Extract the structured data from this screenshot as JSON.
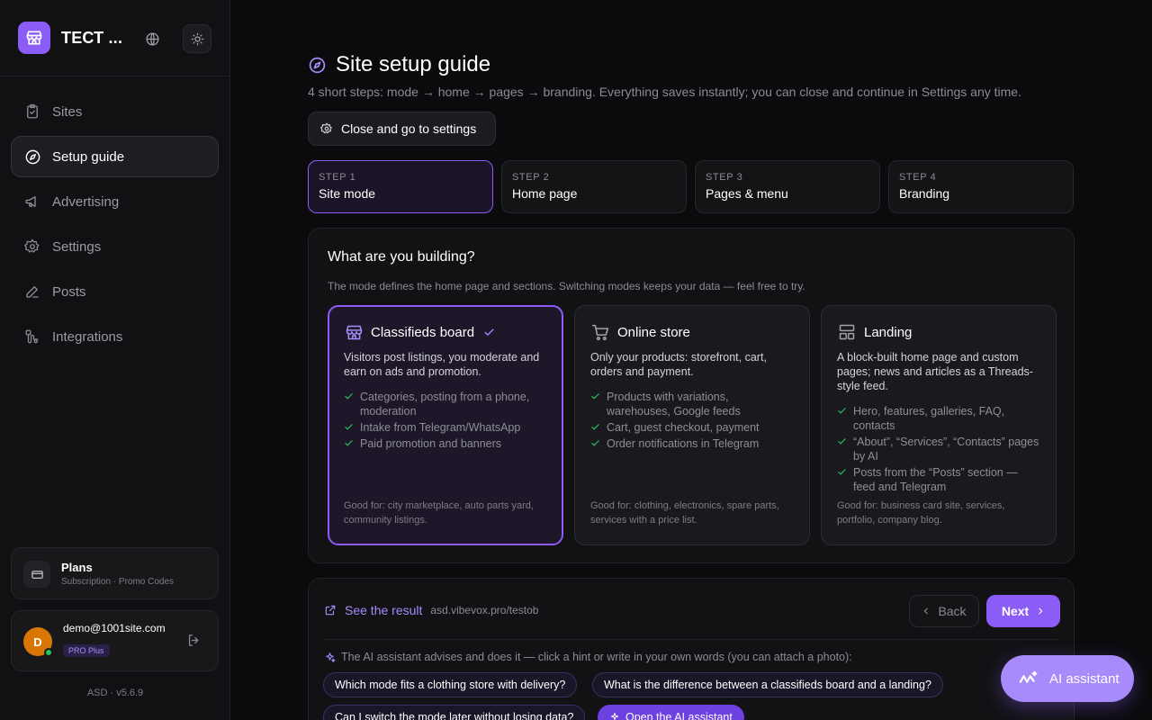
{
  "sidebar": {
    "brand": "ТЕСТ ...",
    "nav": [
      {
        "label": "Sites",
        "icon": "clipboard-check-icon"
      },
      {
        "label": "Setup guide",
        "icon": "compass-icon"
      },
      {
        "label": "Advertising",
        "icon": "megaphone-icon"
      },
      {
        "label": "Settings",
        "icon": "gear-icon"
      },
      {
        "label": "Posts",
        "icon": "pencil-icon"
      },
      {
        "label": "Integrations",
        "icon": "route-icon"
      }
    ],
    "active_nav": "Setup guide",
    "plans": {
      "title": "Plans",
      "subtitle": "Subscription · Promo Codes"
    },
    "user": {
      "initial": "D",
      "email": "demo@1001site.com",
      "badge": "PRO Plus"
    },
    "version": "ASD · v5.6.9"
  },
  "header": {
    "title": "Site setup guide",
    "subtitle": "4 short steps: mode → home → pages → branding. Everything saves instantly; you can close and continue in Settings any time.",
    "close_button": "Close and go to settings"
  },
  "steps": [
    {
      "num": "STEP 1",
      "label": "Site mode"
    },
    {
      "num": "STEP 2",
      "label": "Home page"
    },
    {
      "num": "STEP 3",
      "label": "Pages & menu"
    },
    {
      "num": "STEP 4",
      "label": "Branding"
    }
  ],
  "active_step": "STEP 1",
  "panel": {
    "title": "What are you building?",
    "description": "The mode defines the home page and sections. Switching modes keeps your data — feel free to try.",
    "selected_mode": "Classifieds board",
    "modes": [
      {
        "title": "Classifieds board",
        "icon": "storefront-icon",
        "description": "Visitors post listings, you moderate and earn on ads and promotion.",
        "features": [
          "Categories, posting from a phone, moderation",
          "Intake from Telegram/WhatsApp",
          "Paid promotion and banners"
        ],
        "good_for": "Good for: city marketplace, auto parts yard, community listings."
      },
      {
        "title": "Online store",
        "icon": "cart-icon",
        "description": "Only your products: storefront, cart, orders and payment.",
        "features": [
          "Products with variations, warehouses, Google feeds",
          "Cart, guest checkout, payment",
          "Order notifications in Telegram"
        ],
        "good_for": "Good for: clothing, electronics, spare parts, services with a price list."
      },
      {
        "title": "Landing",
        "icon": "layout-icon",
        "description": "A block-built home page and custom pages; news and articles as a Threads-style feed.",
        "features": [
          "Hero, features, galleries, FAQ, contacts",
          "“About”, “Services”, “Contacts” pages by AI",
          "Posts from the “Posts” section — feed and Telegram"
        ],
        "good_for": "Good for: business card site, services, portfolio, company blog."
      }
    ]
  },
  "bottom": {
    "result_label": "See the result",
    "result_url": "asd.vibevox.pro/testob",
    "back": "Back",
    "next": "Next",
    "ai_tip": "The AI assistant advises and does it — click a hint or write in your own words (you can attach a photo):",
    "hints": [
      "Which mode fits a clothing store with delivery?",
      "What is the difference between a classifieds board and a landing?",
      "Can I switch the mode later without losing data?",
      "Open the AI assistant"
    ]
  },
  "ai_button": "AI assistant",
  "colors": {
    "accent": "#8b5cf6",
    "accent_light": "#a78bfa",
    "check": "#22c55e",
    "bg": "#0b0b0d"
  }
}
